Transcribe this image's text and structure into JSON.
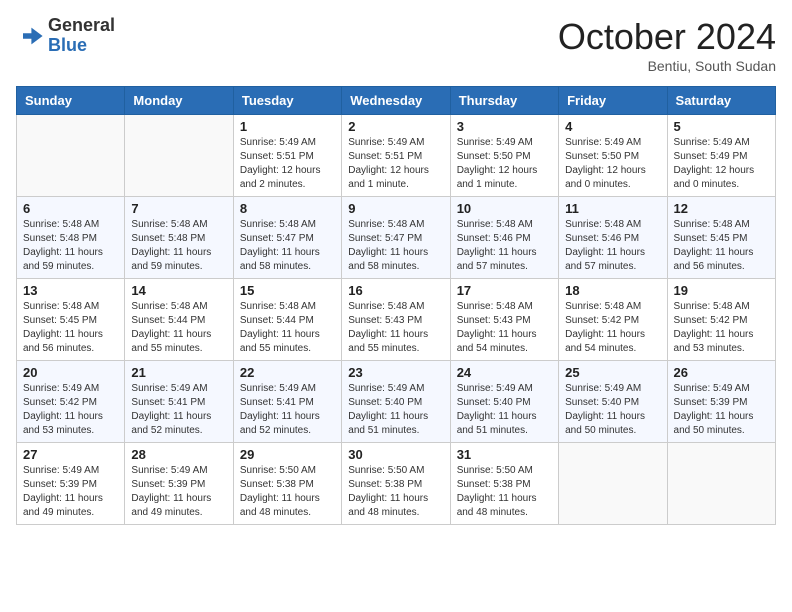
{
  "header": {
    "logo": {
      "general": "General",
      "blue": "Blue"
    },
    "title": "October 2024",
    "subtitle": "Bentiu, South Sudan"
  },
  "calendar": {
    "days_of_week": [
      "Sunday",
      "Monday",
      "Tuesday",
      "Wednesday",
      "Thursday",
      "Friday",
      "Saturday"
    ],
    "weeks": [
      [
        {
          "day": "",
          "info": ""
        },
        {
          "day": "",
          "info": ""
        },
        {
          "day": "1",
          "info": "Sunrise: 5:49 AM\nSunset: 5:51 PM\nDaylight: 12 hours and 2 minutes."
        },
        {
          "day": "2",
          "info": "Sunrise: 5:49 AM\nSunset: 5:51 PM\nDaylight: 12 hours and 1 minute."
        },
        {
          "day": "3",
          "info": "Sunrise: 5:49 AM\nSunset: 5:50 PM\nDaylight: 12 hours and 1 minute."
        },
        {
          "day": "4",
          "info": "Sunrise: 5:49 AM\nSunset: 5:50 PM\nDaylight: 12 hours and 0 minutes."
        },
        {
          "day": "5",
          "info": "Sunrise: 5:49 AM\nSunset: 5:49 PM\nDaylight: 12 hours and 0 minutes."
        }
      ],
      [
        {
          "day": "6",
          "info": "Sunrise: 5:48 AM\nSunset: 5:48 PM\nDaylight: 11 hours and 59 minutes."
        },
        {
          "day": "7",
          "info": "Sunrise: 5:48 AM\nSunset: 5:48 PM\nDaylight: 11 hours and 59 minutes."
        },
        {
          "day": "8",
          "info": "Sunrise: 5:48 AM\nSunset: 5:47 PM\nDaylight: 11 hours and 58 minutes."
        },
        {
          "day": "9",
          "info": "Sunrise: 5:48 AM\nSunset: 5:47 PM\nDaylight: 11 hours and 58 minutes."
        },
        {
          "day": "10",
          "info": "Sunrise: 5:48 AM\nSunset: 5:46 PM\nDaylight: 11 hours and 57 minutes."
        },
        {
          "day": "11",
          "info": "Sunrise: 5:48 AM\nSunset: 5:46 PM\nDaylight: 11 hours and 57 minutes."
        },
        {
          "day": "12",
          "info": "Sunrise: 5:48 AM\nSunset: 5:45 PM\nDaylight: 11 hours and 56 minutes."
        }
      ],
      [
        {
          "day": "13",
          "info": "Sunrise: 5:48 AM\nSunset: 5:45 PM\nDaylight: 11 hours and 56 minutes."
        },
        {
          "day": "14",
          "info": "Sunrise: 5:48 AM\nSunset: 5:44 PM\nDaylight: 11 hours and 55 minutes."
        },
        {
          "day": "15",
          "info": "Sunrise: 5:48 AM\nSunset: 5:44 PM\nDaylight: 11 hours and 55 minutes."
        },
        {
          "day": "16",
          "info": "Sunrise: 5:48 AM\nSunset: 5:43 PM\nDaylight: 11 hours and 55 minutes."
        },
        {
          "day": "17",
          "info": "Sunrise: 5:48 AM\nSunset: 5:43 PM\nDaylight: 11 hours and 54 minutes."
        },
        {
          "day": "18",
          "info": "Sunrise: 5:48 AM\nSunset: 5:42 PM\nDaylight: 11 hours and 54 minutes."
        },
        {
          "day": "19",
          "info": "Sunrise: 5:48 AM\nSunset: 5:42 PM\nDaylight: 11 hours and 53 minutes."
        }
      ],
      [
        {
          "day": "20",
          "info": "Sunrise: 5:49 AM\nSunset: 5:42 PM\nDaylight: 11 hours and 53 minutes."
        },
        {
          "day": "21",
          "info": "Sunrise: 5:49 AM\nSunset: 5:41 PM\nDaylight: 11 hours and 52 minutes."
        },
        {
          "day": "22",
          "info": "Sunrise: 5:49 AM\nSunset: 5:41 PM\nDaylight: 11 hours and 52 minutes."
        },
        {
          "day": "23",
          "info": "Sunrise: 5:49 AM\nSunset: 5:40 PM\nDaylight: 11 hours and 51 minutes."
        },
        {
          "day": "24",
          "info": "Sunrise: 5:49 AM\nSunset: 5:40 PM\nDaylight: 11 hours and 51 minutes."
        },
        {
          "day": "25",
          "info": "Sunrise: 5:49 AM\nSunset: 5:40 PM\nDaylight: 11 hours and 50 minutes."
        },
        {
          "day": "26",
          "info": "Sunrise: 5:49 AM\nSunset: 5:39 PM\nDaylight: 11 hours and 50 minutes."
        }
      ],
      [
        {
          "day": "27",
          "info": "Sunrise: 5:49 AM\nSunset: 5:39 PM\nDaylight: 11 hours and 49 minutes."
        },
        {
          "day": "28",
          "info": "Sunrise: 5:49 AM\nSunset: 5:39 PM\nDaylight: 11 hours and 49 minutes."
        },
        {
          "day": "29",
          "info": "Sunrise: 5:50 AM\nSunset: 5:38 PM\nDaylight: 11 hours and 48 minutes."
        },
        {
          "day": "30",
          "info": "Sunrise: 5:50 AM\nSunset: 5:38 PM\nDaylight: 11 hours and 48 minutes."
        },
        {
          "day": "31",
          "info": "Sunrise: 5:50 AM\nSunset: 5:38 PM\nDaylight: 11 hours and 48 minutes."
        },
        {
          "day": "",
          "info": ""
        },
        {
          "day": "",
          "info": ""
        }
      ]
    ]
  }
}
